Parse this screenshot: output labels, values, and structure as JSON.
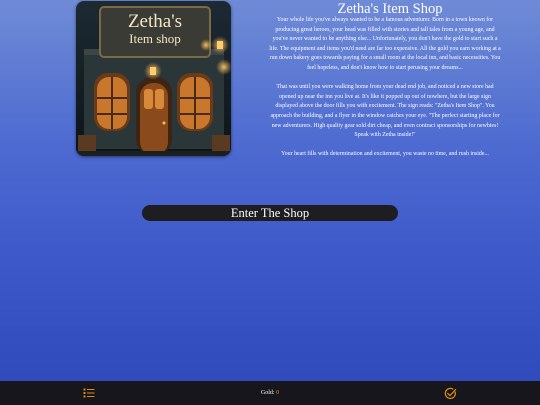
{
  "colors": {
    "accent": "#e0a400",
    "button_bg": "#1e1d22",
    "bar_bg": "#17161c"
  },
  "hero": {
    "sign_line1": "Zetha's",
    "sign_line2": "Item shop"
  },
  "title": "Zetha's Item Shop",
  "story": {
    "paragraph1": "Your whole life you've always wanted to be a famous adventurer. Born in a town known for producing great heroes, your head was filled with stories and tall tales from a young age, and you've never wanted to be anything else... Unfortunately, you don't have the gold to start such a life. The equipment and items you'd need are far too expensive. All the gold you earn working at a run down bakery goes towards paying for a small room at the local inn, and basic necessities. You feel hopeless, and don't know how to start perusing your dreams...",
    "paragraph2": "That was until you were walking home from your dead end job, and noticed a new store had opened up near the inn you live at. It's like it popped up out of nowhere, but the large sign displayed above the door fills you with excitement. The sign reads: \"Zetha's Item Shop\". You approach the building, and a flyer in the window catches your eye. \"The perfect starting place for new adventurers. High quality gear sold dirt cheap, and even contract sponsorships for newbies! Speak with Zetha inside!\"",
    "paragraph3": "Your heart fills with determination and excitement, you waste no time, and rush inside..."
  },
  "enter_button": "Enter The Shop",
  "bottom_bar": {
    "gold_label": "Gold:",
    "gold_amount": "0",
    "left_icon": "quest-list-icon",
    "right_icon": "check-circle-icon"
  }
}
